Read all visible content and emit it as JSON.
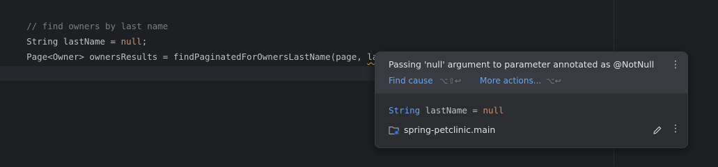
{
  "editor": {
    "line1": {
      "comment": "// find owners by last name"
    },
    "line2": {
      "type": "String",
      "rest": " lastName = ",
      "null_kw": "null",
      "semi": ";"
    },
    "line3": {
      "prefix": "Page<Owner> ownersResults = findPaginatedForOwnersLastName(page, ",
      "arg": "lastName",
      "suffix": ");"
    }
  },
  "popup": {
    "message": "Passing 'null' argument to parameter annotated as @NotNull",
    "menu_icon": "⋮",
    "find_cause_label": "Find cause",
    "find_cause_shortcut": "⌥⇧↩",
    "more_actions_label": "More actions...",
    "more_actions_shortcut": "⌥↩",
    "code": {
      "kw": "String",
      "rest": " lastName = ",
      "null_kw": "null"
    },
    "module_name": "spring-petclinic.main",
    "footer_menu_icon": "⋮"
  },
  "colors": {
    "background": "#1e1f22",
    "comment": "#7a7e85",
    "keyword_null": "#cf8e6d",
    "link": "#5ea6ff",
    "warning_underline": "#e0b341"
  },
  "icons": [
    "more-vertical-icon",
    "module-folder-icon",
    "edit-pencil-icon"
  ]
}
